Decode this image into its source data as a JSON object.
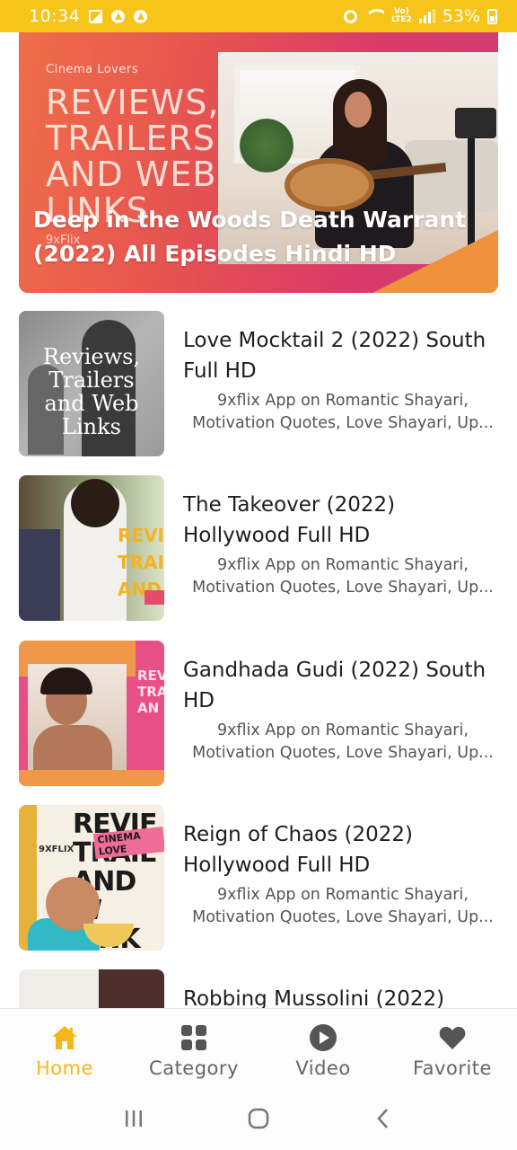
{
  "status_bar": {
    "time": "10:34",
    "lte_top": "Vo)",
    "lte_bottom": "LTE2",
    "battery": "53%"
  },
  "hero": {
    "brand_small": "Cinema Lovers",
    "brand_big": "REVIEWS, TRAILERS AND WEB LINKS",
    "brand_mark": "9xFlix",
    "title": "Deep in the Woods Death Warrant (2022) All Episodes Hindi HD"
  },
  "items": [
    {
      "title": "Love Mocktail 2 (2022) South Full HD",
      "description": "9xflix App on Romantic Shayari, Motivation Quotes, Love Shayari, Up...",
      "thumb_text": "Reviews, Trailers and Web Links"
    },
    {
      "title": "The Takeover (2022) Hollywood Full HD",
      "description": "9xflix App on Romantic Shayari, Motivation Quotes, Love Shayari, Up...",
      "thumb_text": "REVI TRAI AND"
    },
    {
      "title": "Gandhada Gudi (2022) South HD",
      "description": "9xflix App on Romantic Shayari, Motivation Quotes, Love Shayari, Up...",
      "thumb_text": "REV TRA AN"
    },
    {
      "title": "Reign of Chaos (2022) Hollywood Full HD",
      "description": "9xflix App on Romantic Shayari, Motivation Quotes, Love Shayari, Up...",
      "thumb_mark": "9XFLIX",
      "thumb_tag": "CINEMA LOVE",
      "thumb_text": "REVIE TRAIL AND W LINK"
    },
    {
      "title": "Robbing Mussolini (2022)"
    }
  ],
  "bottom_nav": {
    "items": [
      {
        "label": "Home",
        "icon": "home-icon",
        "active": true
      },
      {
        "label": "Category",
        "icon": "category-icon",
        "active": false
      },
      {
        "label": "Video",
        "icon": "video-icon",
        "active": false
      },
      {
        "label": "Favorite",
        "icon": "heart-icon",
        "active": false
      }
    ]
  },
  "colors": {
    "accent": "#f5b71d",
    "status_bar": "#f7c41a",
    "icon_gray": "#555555"
  }
}
